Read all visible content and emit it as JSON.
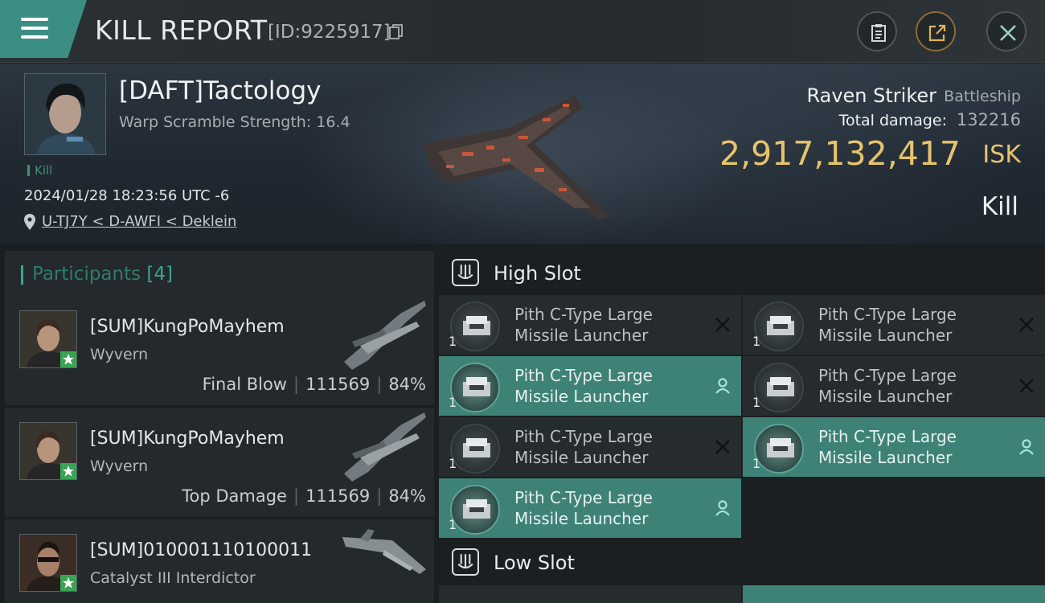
{
  "header": {
    "title": "KILL REPORT",
    "report_id": "[ID:9225917]"
  },
  "victim": {
    "name": "[DAFT]Tactology",
    "warp_scramble": "Warp Scramble Strength: 16.4",
    "kill_tag": "Kill",
    "timestamp": "2024/01/28 18:23:56 UTC -6",
    "location": "U-TJ7Y < D-AWFI < Deklein"
  },
  "ship": {
    "name": "Raven Striker",
    "class": "Battleship",
    "total_damage_label": "Total damage:",
    "total_damage": "132216",
    "isk_value": "2,917,132,417",
    "isk_unit": "ISK",
    "result": "Kill"
  },
  "participants": {
    "title": "Participants",
    "count": "[4]",
    "rows": [
      {
        "name": "[SUM]KungPoMayhem",
        "ship": "Wyvern",
        "role": "Final Blow",
        "damage": "111569",
        "percent": "84%"
      },
      {
        "name": "[SUM]KungPoMayhem",
        "ship": "Wyvern",
        "role": "Top Damage",
        "damage": "111569",
        "percent": "84%"
      },
      {
        "name": "[SUM]010001110100011",
        "ship": "Catalyst III Interdictor"
      }
    ]
  },
  "fitting": {
    "high_slot_label": "High Slot",
    "low_slot_label": "Low Slot",
    "module_line1": "Pith C-Type Large",
    "module_line2": "Missile Launcher",
    "module_qty": "1"
  },
  "colors": {
    "accent": "#3d8e82",
    "isk": "#e6c46c",
    "highlight_row": "#3e8277"
  }
}
